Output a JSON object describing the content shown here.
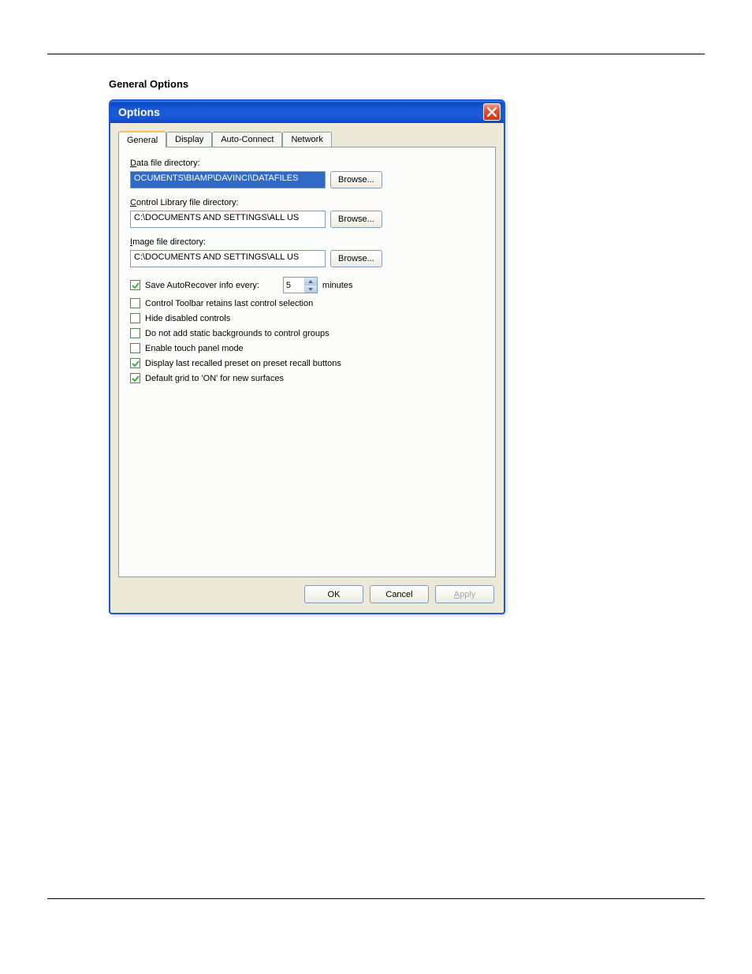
{
  "section_title": "General Options",
  "dialog": {
    "title": "Options",
    "tabs": [
      "General",
      "Display",
      "Auto-Connect",
      "Network"
    ],
    "active_tab": 0,
    "fields": {
      "data_dir": {
        "label_prefix": "D",
        "label_rest": "ata file directory:",
        "value": "OCUMENTS\\BIAMP\\DAVINCI\\DATAFILES",
        "browse": "Browse..."
      },
      "ctrl_lib_dir": {
        "label_prefix": "C",
        "label_rest": "ontrol Library file directory:",
        "value": "C:\\DOCUMENTS AND SETTINGS\\ALL US",
        "browse": "Browse..."
      },
      "image_dir": {
        "label_prefix": "I",
        "label_rest": "mage file directory:",
        "value": "C:\\DOCUMENTS AND SETTINGS\\ALL US",
        "browse": "Browse..."
      }
    },
    "autorecover": {
      "label": "Save AutoRecover info every:",
      "value": "5",
      "unit": "minutes",
      "checked": true
    },
    "checkboxes": [
      {
        "label": "Control Toolbar retains last control selection",
        "checked": false
      },
      {
        "label": "Hide disabled controls",
        "checked": false
      },
      {
        "label": "Do not add static backgrounds to control groups",
        "checked": false
      },
      {
        "label": "Enable touch panel mode",
        "checked": false
      },
      {
        "label": "Display last recalled preset on preset recall buttons",
        "checked": true
      },
      {
        "label": "Default grid to 'ON' for new surfaces",
        "checked": true
      }
    ],
    "buttons": {
      "ok": "OK",
      "cancel": "Cancel",
      "apply_prefix": "A",
      "apply_rest": "pply"
    }
  }
}
